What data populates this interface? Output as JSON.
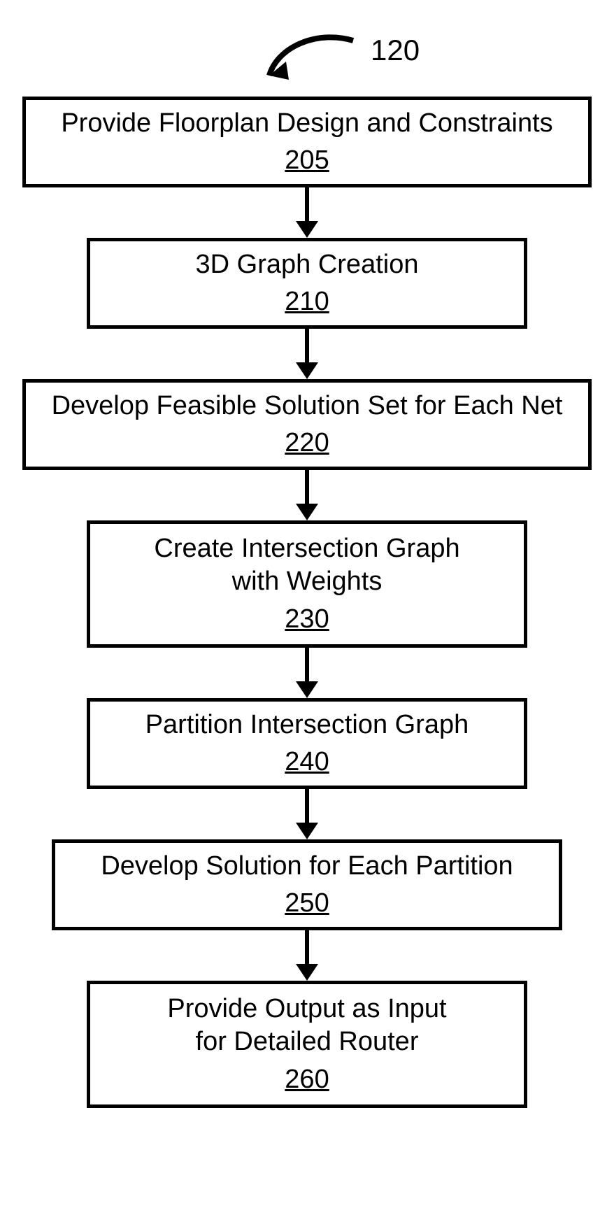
{
  "diagram_label": "120",
  "steps": [
    {
      "id": "205",
      "title": "Provide Floorplan Design and Constraints",
      "ref": "205"
    },
    {
      "id": "210",
      "title": "3D Graph Creation",
      "ref": "210"
    },
    {
      "id": "220",
      "title": "Develop Feasible Solution Set for Each Net",
      "ref": "220"
    },
    {
      "id": "230",
      "title": "Create Intersection Graph\nwith Weights",
      "ref": "230"
    },
    {
      "id": "240",
      "title": "Partition Intersection Graph",
      "ref": "240"
    },
    {
      "id": "250",
      "title": "Develop Solution for Each Partition",
      "ref": "250"
    },
    {
      "id": "260",
      "title": "Provide Output as Input\nfor Detailed Router",
      "ref": "260"
    }
  ]
}
